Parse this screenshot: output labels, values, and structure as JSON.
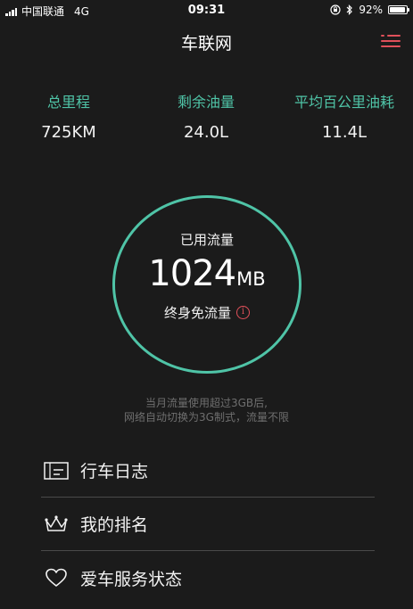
{
  "status_bar": {
    "carrier": "中国联通",
    "network": "4G",
    "time": "09:31",
    "battery_percent": "92%",
    "battery_level": 0.92,
    "icons": [
      "signal-icon",
      "orientation-lock-icon",
      "bluetooth-icon",
      "battery-icon"
    ]
  },
  "header": {
    "title": "车联网",
    "menu_icon": "hamburger-menu-icon"
  },
  "stats": [
    {
      "label": "总里程",
      "value": "725KM"
    },
    {
      "label": "剩余油量",
      "value": "24.0L"
    },
    {
      "label": "平均百公里油耗",
      "value": "11.4L"
    }
  ],
  "data_ring": {
    "label": "已用流量",
    "value": "1024",
    "unit": "MB",
    "subtitle": "终身免流量",
    "info_icon": "i"
  },
  "notice": {
    "line1": "当月流量使用超过3GB后,",
    "line2": "网络自动切换为3G制式，流量不限"
  },
  "menu_list": [
    {
      "label": "行车日志",
      "icon": "logbook-icon"
    },
    {
      "label": "我的排名",
      "icon": "crown-icon"
    },
    {
      "label": "爱车服务状态",
      "icon": "heart-icon"
    }
  ],
  "colors": {
    "background": "#1b1b1b",
    "accent_teal": "#4fc4a7",
    "accent_red": "#e0505a",
    "divider": "#4a4a4a",
    "muted_text": "#6f6f6f"
  }
}
